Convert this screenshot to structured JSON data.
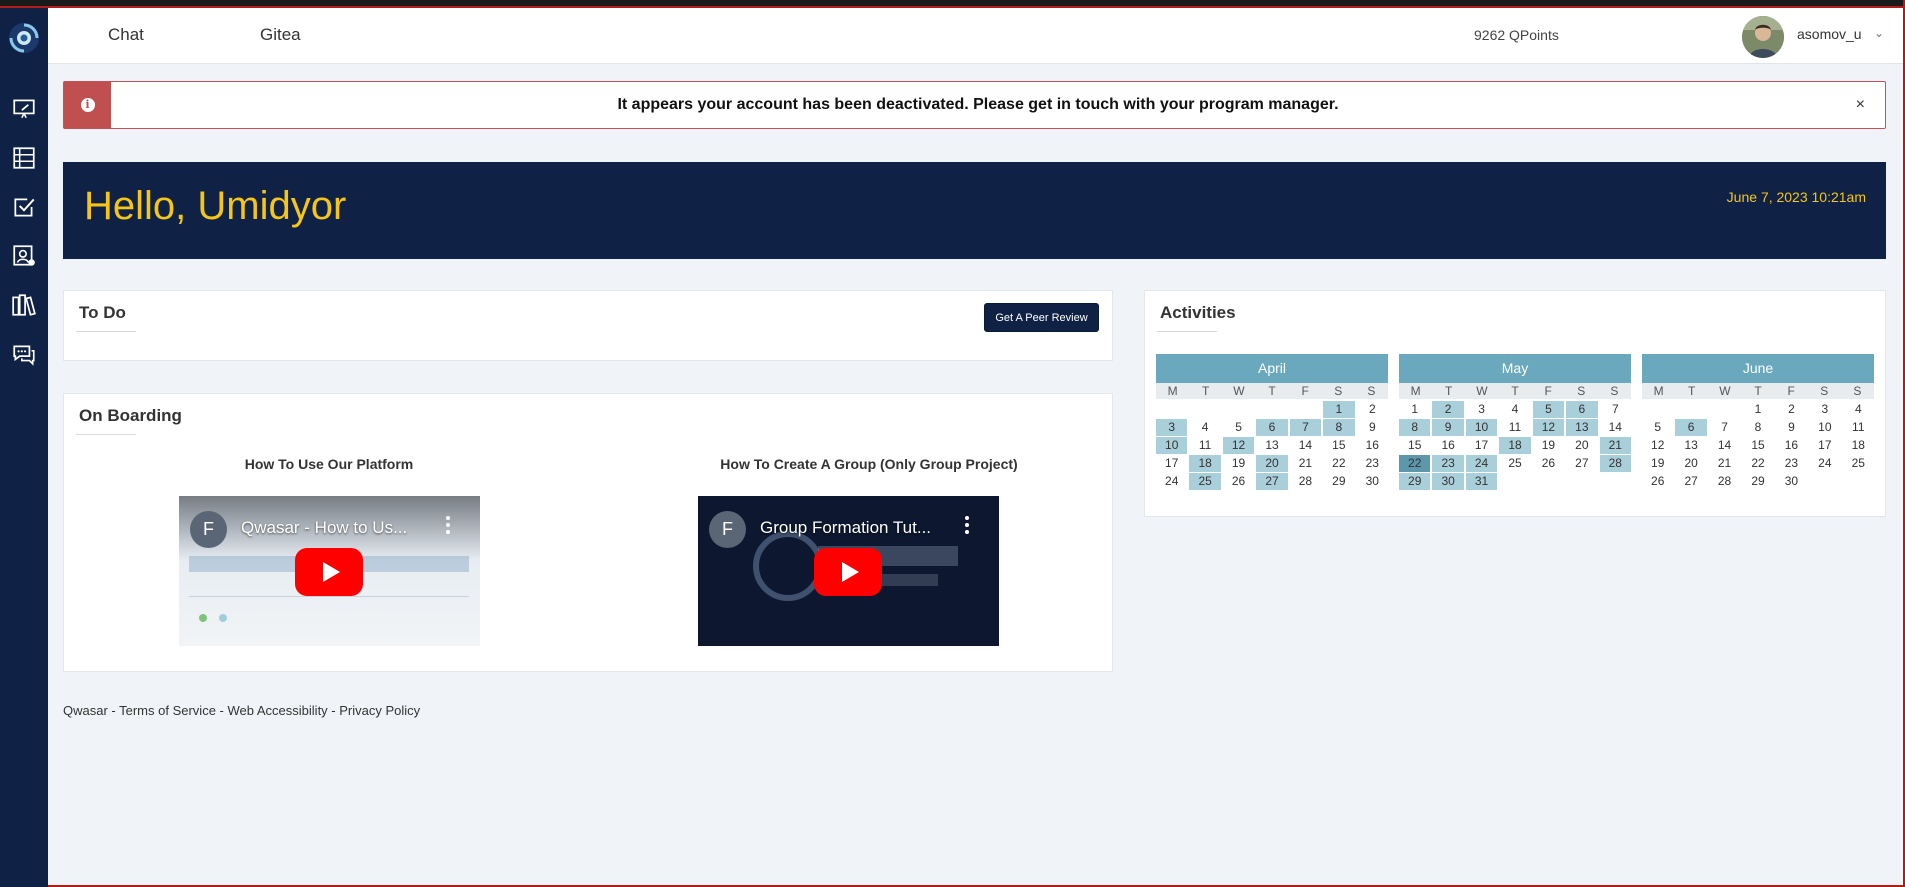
{
  "nav": {
    "chat": "Chat",
    "gitea": "Gitea"
  },
  "user": {
    "points": "9262 QPoints",
    "username": "asomov_u"
  },
  "alert": {
    "text": "It appears your account has been deactivated. Please get in touch with your program manager.",
    "close": "×"
  },
  "hero": {
    "greeting": "Hello, Umidyor",
    "datetime": "June 7, 2023 10:21am"
  },
  "todo": {
    "title": "To Do",
    "button": "Get A Peer Review"
  },
  "onboarding": {
    "title": "On Boarding",
    "videos": [
      {
        "heading": "How To Use Our Platform",
        "video_title": "Qwasar - How to Us...",
        "channel_initial": "F"
      },
      {
        "heading": "How To Create A Group (Only Group Project)",
        "video_title": "Group Formation Tut...",
        "channel_initial": "F"
      }
    ]
  },
  "activities": {
    "title": "Activities",
    "dow": [
      "M",
      "T",
      "W",
      "T",
      "F",
      "S",
      "S"
    ],
    "months": [
      {
        "name": "April",
        "lead": 5,
        "days": 30,
        "highlighted": [
          1,
          3,
          6,
          7,
          8,
          10,
          12,
          18,
          20,
          25,
          27
        ],
        "strong": []
      },
      {
        "name": "May",
        "lead": 0,
        "days": 31,
        "highlighted": [
          2,
          5,
          6,
          8,
          9,
          10,
          12,
          13,
          18,
          21,
          23,
          24,
          28,
          29,
          30,
          31
        ],
        "strong": [
          22
        ]
      },
      {
        "name": "June",
        "lead": 3,
        "days": 30,
        "highlighted": [
          6
        ],
        "strong": []
      }
    ]
  },
  "footer": {
    "brand": "Qwasar",
    "terms": "Terms of Service",
    "accessibility": "Web Accessibility",
    "privacy": "Privacy Policy",
    "sep": " - "
  },
  "icons": [
    "logo-icon",
    "presentation-icon",
    "list-icon",
    "checkbox-icon",
    "user-card-icon",
    "books-icon",
    "chat-bubbles-icon"
  ],
  "colors": {
    "navy": "#0f2245",
    "accent": "#f5c518",
    "alert": "#c0504f",
    "calendar": "#6aa8bd"
  }
}
